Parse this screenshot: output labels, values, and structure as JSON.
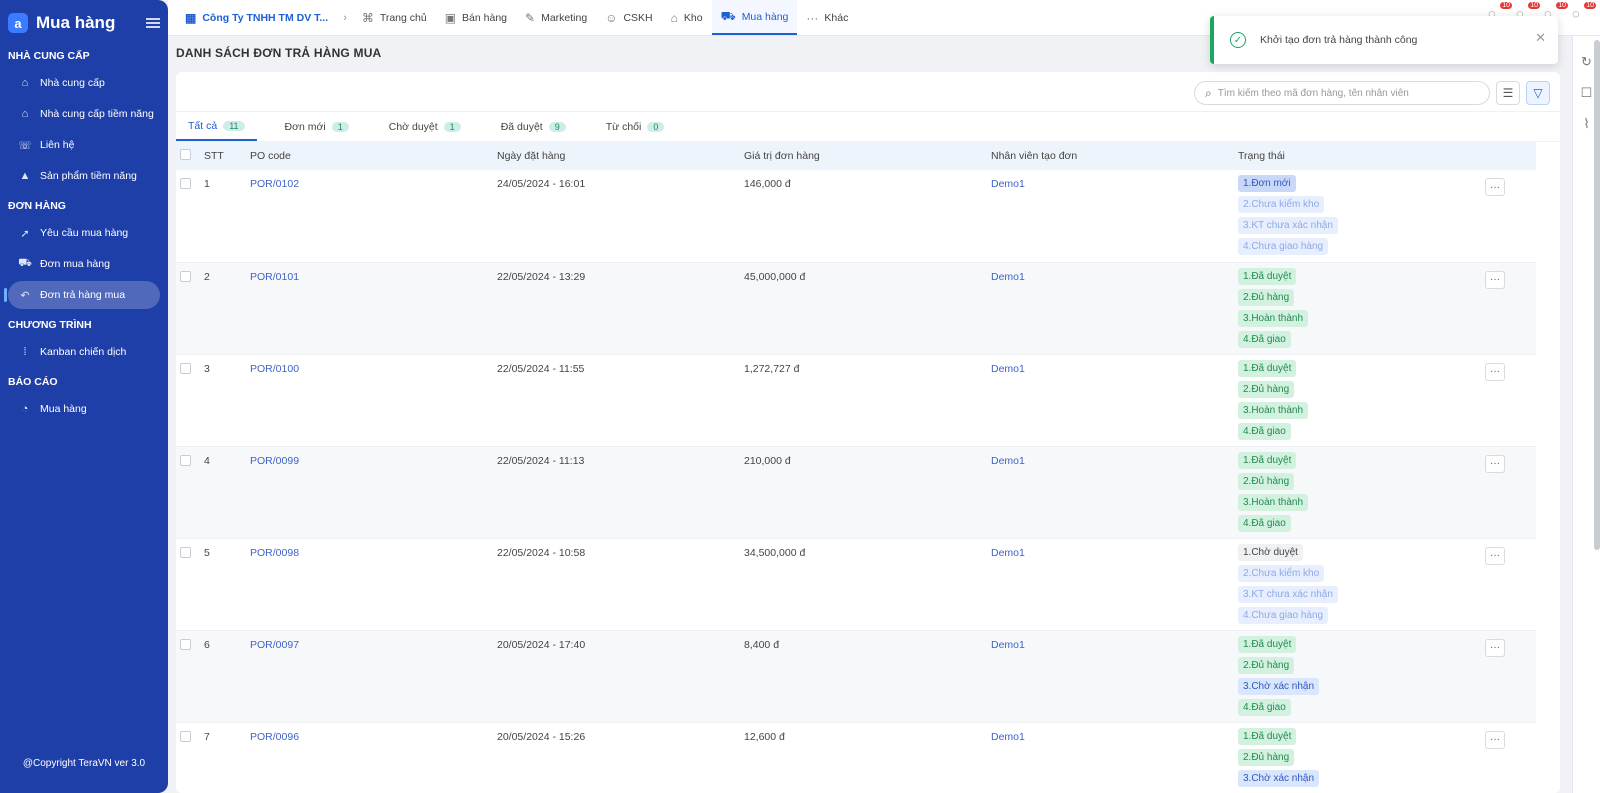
{
  "sidebar": {
    "title": "Mua hàng",
    "logo_letter": "a",
    "sections": [
      {
        "label": "NHÀ CUNG CẤP",
        "items": [
          {
            "label": "Nhà cung cấp",
            "icon": "building-icon",
            "glyph": "⌂",
            "active": false
          },
          {
            "label": "Nhà cung cấp tiềm năng",
            "icon": "building-potential-icon",
            "glyph": "⌂",
            "active": false
          },
          {
            "label": "Liên hệ",
            "icon": "phone-icon",
            "glyph": "☏",
            "active": false
          },
          {
            "label": "Sản phẩm tiềm năng",
            "icon": "product-icon",
            "glyph": "▲",
            "active": false
          }
        ]
      },
      {
        "label": "ĐƠN HÀNG",
        "items": [
          {
            "label": "Yêu cầu mua hàng",
            "icon": "rocket-icon",
            "glyph": "➚",
            "active": false
          },
          {
            "label": "Đơn mua hàng",
            "icon": "cart-icon",
            "glyph": "⛟",
            "active": false
          },
          {
            "label": "Đơn trả hàng mua",
            "icon": "return-icon",
            "glyph": "↶",
            "active": true
          }
        ]
      },
      {
        "label": "CHƯƠNG TRÌNH",
        "items": [
          {
            "label": "Kanban chiến dịch",
            "icon": "kanban-icon",
            "glyph": "⁞",
            "active": false
          }
        ]
      },
      {
        "label": "BÁO CÁO",
        "items": [
          {
            "label": "Mua hàng",
            "icon": "report-icon",
            "glyph": "◔",
            "active": false
          }
        ]
      }
    ],
    "footer": "@Copyright TeraVN ver 3.0"
  },
  "topnav": {
    "company": "Công Ty TNHH TM DV T...",
    "items": [
      {
        "label": "Trang chủ",
        "icon": "home-icon",
        "glyph": "⌘",
        "active": false
      },
      {
        "label": "Bán hàng",
        "icon": "box-icon",
        "glyph": "▣",
        "active": false
      },
      {
        "label": "Marketing",
        "icon": "marketing-icon",
        "glyph": "✎",
        "active": false
      },
      {
        "label": "CSKH",
        "icon": "support-icon",
        "glyph": "☺",
        "active": false
      },
      {
        "label": "Kho",
        "icon": "warehouse-icon",
        "glyph": "⌂",
        "active": false
      },
      {
        "label": "Mua hàng",
        "icon": "cart-icon",
        "glyph": "⛟",
        "active": true
      },
      {
        "label": "Khác",
        "icon": "more-icon",
        "glyph": "···",
        "active": false
      }
    ],
    "notification_counts": [
      "10",
      "10",
      "10",
      "10"
    ]
  },
  "page": {
    "title": "DANH SÁCH ĐƠN TRẢ HÀNG MUA",
    "search_placeholder": "Tìm kiếm theo mã đơn hàng, tên nhân viên"
  },
  "tabs": [
    {
      "label": "Tất cả",
      "count": "11",
      "active": true
    },
    {
      "label": "Đơn mới",
      "count": "1",
      "active": false
    },
    {
      "label": "Chờ duyệt",
      "count": "1",
      "active": false
    },
    {
      "label": "Đã duyệt",
      "count": "9",
      "active": false
    },
    {
      "label": "Từ chối",
      "count": "0",
      "active": false
    }
  ],
  "table": {
    "headers": [
      "STT",
      "PO code",
      "Ngày đặt hàng",
      "Giá trị đơn hàng",
      "Nhân viên tạo đơn",
      "Trạng thái"
    ],
    "rows": [
      {
        "stt": "1",
        "po": "POR/0102",
        "date": "24/05/2024 - 16:01",
        "value": "146,000 đ",
        "employee": "Demo1",
        "statuses": [
          {
            "t": "1.Đơn mới",
            "k": "new"
          },
          {
            "t": "2.Chưa kiểm kho",
            "k": "pending-soft"
          },
          {
            "t": "3.KT chưa xác nhận",
            "k": "pending-soft"
          },
          {
            "t": "4.Chưa giao hàng",
            "k": "pending-soft"
          }
        ]
      },
      {
        "stt": "2",
        "po": "POR/0101",
        "date": "22/05/2024 - 13:29",
        "value": "45,000,000 đ",
        "employee": "Demo1",
        "statuses": [
          {
            "t": "1.Đã duyệt",
            "k": "ok"
          },
          {
            "t": "2.Đủ hàng",
            "k": "ok"
          },
          {
            "t": "3.Hoàn thành",
            "k": "ok"
          },
          {
            "t": "4.Đã giao",
            "k": "ok"
          }
        ]
      },
      {
        "stt": "3",
        "po": "POR/0100",
        "date": "22/05/2024 - 11:55",
        "value": "1,272,727 đ",
        "employee": "Demo1",
        "statuses": [
          {
            "t": "1.Đã duyệt",
            "k": "ok"
          },
          {
            "t": "2.Đủ hàng",
            "k": "ok"
          },
          {
            "t": "3.Hoàn thành",
            "k": "ok"
          },
          {
            "t": "4.Đã giao",
            "k": "ok"
          }
        ]
      },
      {
        "stt": "4",
        "po": "POR/0099",
        "date": "22/05/2024 - 11:13",
        "value": "210,000 đ",
        "employee": "Demo1",
        "statuses": [
          {
            "t": "1.Đã duyệt",
            "k": "ok"
          },
          {
            "t": "2.Đủ hàng",
            "k": "ok"
          },
          {
            "t": "3.Hoàn thành",
            "k": "ok"
          },
          {
            "t": "4.Đã giao",
            "k": "ok"
          }
        ]
      },
      {
        "stt": "5",
        "po": "POR/0098",
        "date": "22/05/2024 - 10:58",
        "value": "34,500,000 đ",
        "employee": "Demo1",
        "statuses": [
          {
            "t": "1.Chờ duyệt",
            "k": "gray"
          },
          {
            "t": "2.Chưa kiểm kho",
            "k": "pending-soft"
          },
          {
            "t": "3.KT chưa xác nhận",
            "k": "pending-soft"
          },
          {
            "t": "4.Chưa giao hàng",
            "k": "pending-soft"
          }
        ]
      },
      {
        "stt": "6",
        "po": "POR/0097",
        "date": "20/05/2024 - 17:40",
        "value": "8,400 đ",
        "employee": "Demo1",
        "statuses": [
          {
            "t": "1.Đã duyệt",
            "k": "ok"
          },
          {
            "t": "2.Đủ hàng",
            "k": "ok"
          },
          {
            "t": "3.Chờ xác nhận",
            "k": "blue"
          },
          {
            "t": "4.Đã giao",
            "k": "ok"
          }
        ]
      },
      {
        "stt": "7",
        "po": "POR/0096",
        "date": "20/05/2024 - 15:26",
        "value": "12,600 đ",
        "employee": "Demo1",
        "statuses": [
          {
            "t": "1.Đã duyệt",
            "k": "ok"
          },
          {
            "t": "2.Đủ hàng",
            "k": "ok"
          },
          {
            "t": "3.Chờ xác nhận",
            "k": "blue"
          }
        ]
      }
    ]
  },
  "toast": {
    "message": "Khởi tạo đơn trả hàng thành công"
  },
  "colors": {
    "sidebar": "#1f3fa8",
    "accent": "#1f5fd6",
    "success": "#1aa860"
  }
}
